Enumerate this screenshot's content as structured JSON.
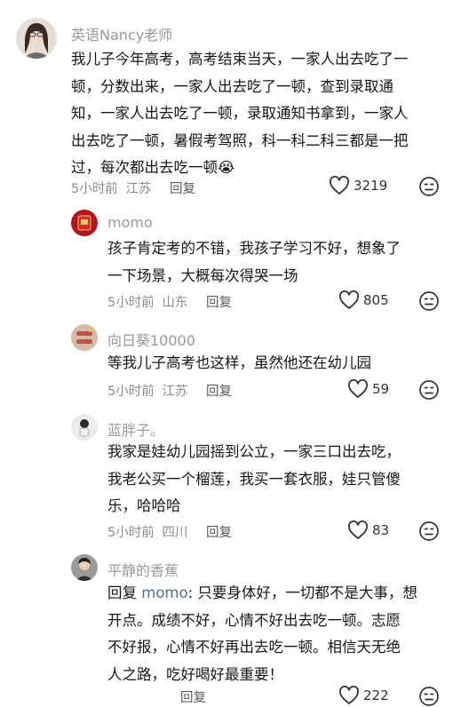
{
  "comments": [
    {
      "name": "英语Nancy老师",
      "lines": [
        "我儿子今年高考，高考结束当天，一家人出去吃了一",
        "顿，分数出来，一家人出去吃了一顿，查到录取通",
        "知，一家人出去吃了一顿，录取通知书拿到，一家人",
        "出去吃了一顿，暑假考驾照，科一科二科三都是一把",
        "过，每次都出去吃一顿"
      ],
      "emoji": "😭",
      "time": "5小时前",
      "location": "江苏",
      "reply": "回复",
      "likes": "3219"
    },
    {
      "name": "momo",
      "lines": [
        "孩子肯定考的不错，我孩子学习不好，想象了",
        "一下场景，大概每次得哭一场"
      ],
      "time": "5小时前",
      "location": "山东",
      "reply": "回复",
      "likes": "805"
    },
    {
      "name": "向日葵10000",
      "lines": [
        "等我儿子高考也这样，虽然他还在幼儿园"
      ],
      "time": "5小时前",
      "location": "江苏",
      "reply": "回复",
      "likes": "59"
    },
    {
      "name": "蓝胖子。",
      "lines": [
        "我家是娃幼儿园摇到公立，一家三口出去吃，",
        "我老公买一个榴莲，我买一套衣服，娃只管傻",
        "乐，哈哈哈"
      ],
      "time": "5小时前",
      "location": "四川",
      "reply": "回复",
      "likes": "83"
    },
    {
      "name": "平静的香蕉",
      "reply_prefix": "回复",
      "reply_target": "momo",
      "first_line_rest": ": 只要身体好，一切都不是大事，想",
      "lines": [
        "开点。成绩不好，心情不好出去吃一顿。志愿",
        "不好报，心情不好再出去吃一顿。相信天无绝",
        "人之路，吃好喝好最重要！"
      ],
      "reply": "回复",
      "likes": "222"
    }
  ],
  "icons": {
    "like": "heart-outline-icon",
    "dislike": "frown-face-icon"
  },
  "colors": {
    "text": "#161616",
    "muted": "#8d8d8d",
    "mention": "#5c6b8a"
  }
}
